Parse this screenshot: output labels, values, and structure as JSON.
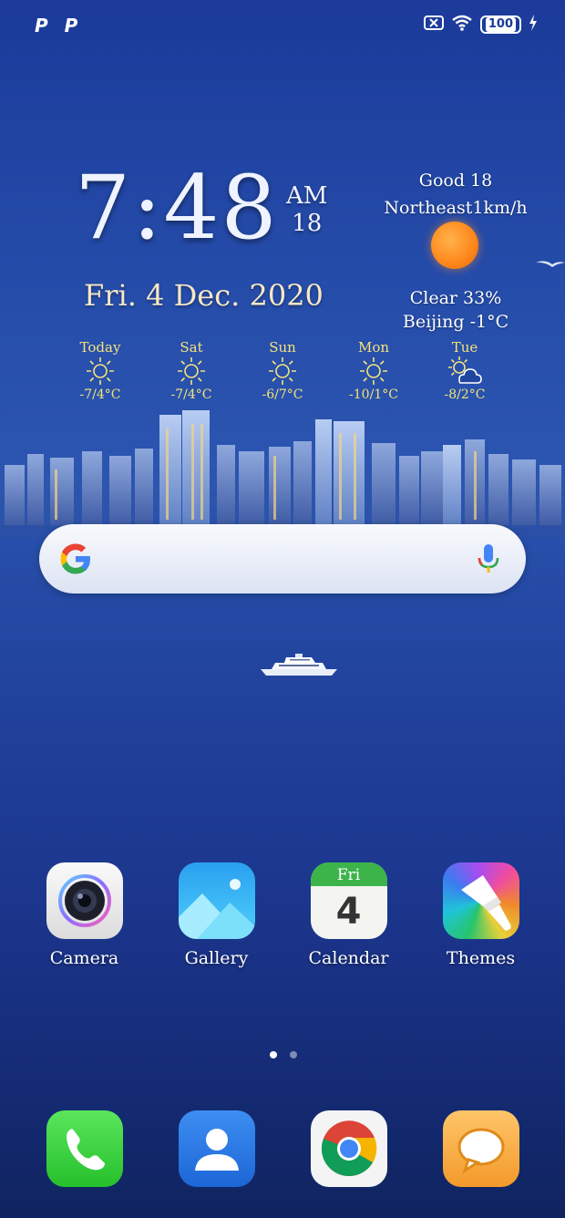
{
  "status_bar": {
    "left_icons": [
      "P",
      "P"
    ],
    "battery": "100"
  },
  "clock": {
    "time": "7:48",
    "ampm": "AM",
    "seconds": "18",
    "date": "Fri. 4 Dec. 2020"
  },
  "weather": {
    "air_quality": "Good 18",
    "wind": "Northeast1km/h",
    "condition": "Clear 33%",
    "location_temp": "Beijing -1°C",
    "forecast": [
      {
        "day": "Today",
        "icon": "sun-icon",
        "temp": "-7/4°C"
      },
      {
        "day": "Sat",
        "icon": "sun-icon",
        "temp": "-7/4°C"
      },
      {
        "day": "Sun",
        "icon": "sun-icon",
        "temp": "-6/7°C"
      },
      {
        "day": "Mon",
        "icon": "sun-icon",
        "temp": "-10/1°C"
      },
      {
        "day": "Tue",
        "icon": "partly-cloudy-icon",
        "temp": "-8/2°C"
      }
    ]
  },
  "search": {
    "left_icon": "google-g-icon",
    "right_icon": "microphone-icon"
  },
  "apps": [
    {
      "label": "Camera",
      "icon": "camera-icon"
    },
    {
      "label": "Gallery",
      "icon": "gallery-icon"
    },
    {
      "label": "Calendar",
      "icon": "calendar-icon",
      "day": "Fri",
      "date": "4"
    },
    {
      "label": "Themes",
      "icon": "themes-icon"
    }
  ],
  "dock": [
    {
      "icon": "phone-icon"
    },
    {
      "icon": "contacts-icon"
    },
    {
      "icon": "chrome-icon"
    },
    {
      "icon": "messages-icon"
    }
  ],
  "page_indicator": {
    "pages": 2,
    "current": 1
  },
  "colors": {
    "date_text": "#f7e8c4",
    "forecast_text": "#f5e37a",
    "sun": "#ff8a1e"
  }
}
